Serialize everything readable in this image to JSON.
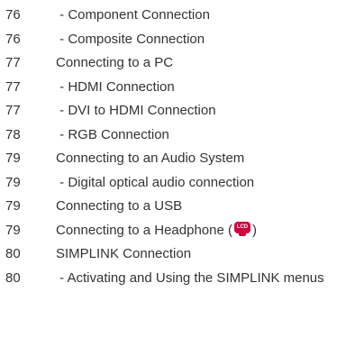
{
  "entries": [
    {
      "page": "76",
      "title": " - Component Connection"
    },
    {
      "page": "76",
      "title": " - Composite Connection"
    },
    {
      "page": "77",
      "title": "Connecting to a PC"
    },
    {
      "page": "77",
      "title": " - HDMI Connection"
    },
    {
      "page": "77",
      "title": " - DVI to HDMI Connection"
    },
    {
      "page": "78",
      "title": " - RGB Connection"
    },
    {
      "page": "79",
      "title": "Connecting to an Audio System"
    },
    {
      "page": "79",
      "title": " - Digital optical audio connection"
    },
    {
      "page": "79",
      "title": "Connecting to a USB"
    },
    {
      "page": "79",
      "title": "Connecting to a Headphone (",
      "title_suffix": ")",
      "icon_text": "LCD"
    },
    {
      "page": "80",
      "title": "SIMPLINK Connection"
    },
    {
      "page": "80",
      "title": " - Activating and Using the SIMPLINK menus"
    }
  ],
  "colors": {
    "text": "#333333",
    "lcd_icon": "#d2003c"
  },
  "icons": {
    "headphone_entry": "lcd-tv-icon"
  }
}
